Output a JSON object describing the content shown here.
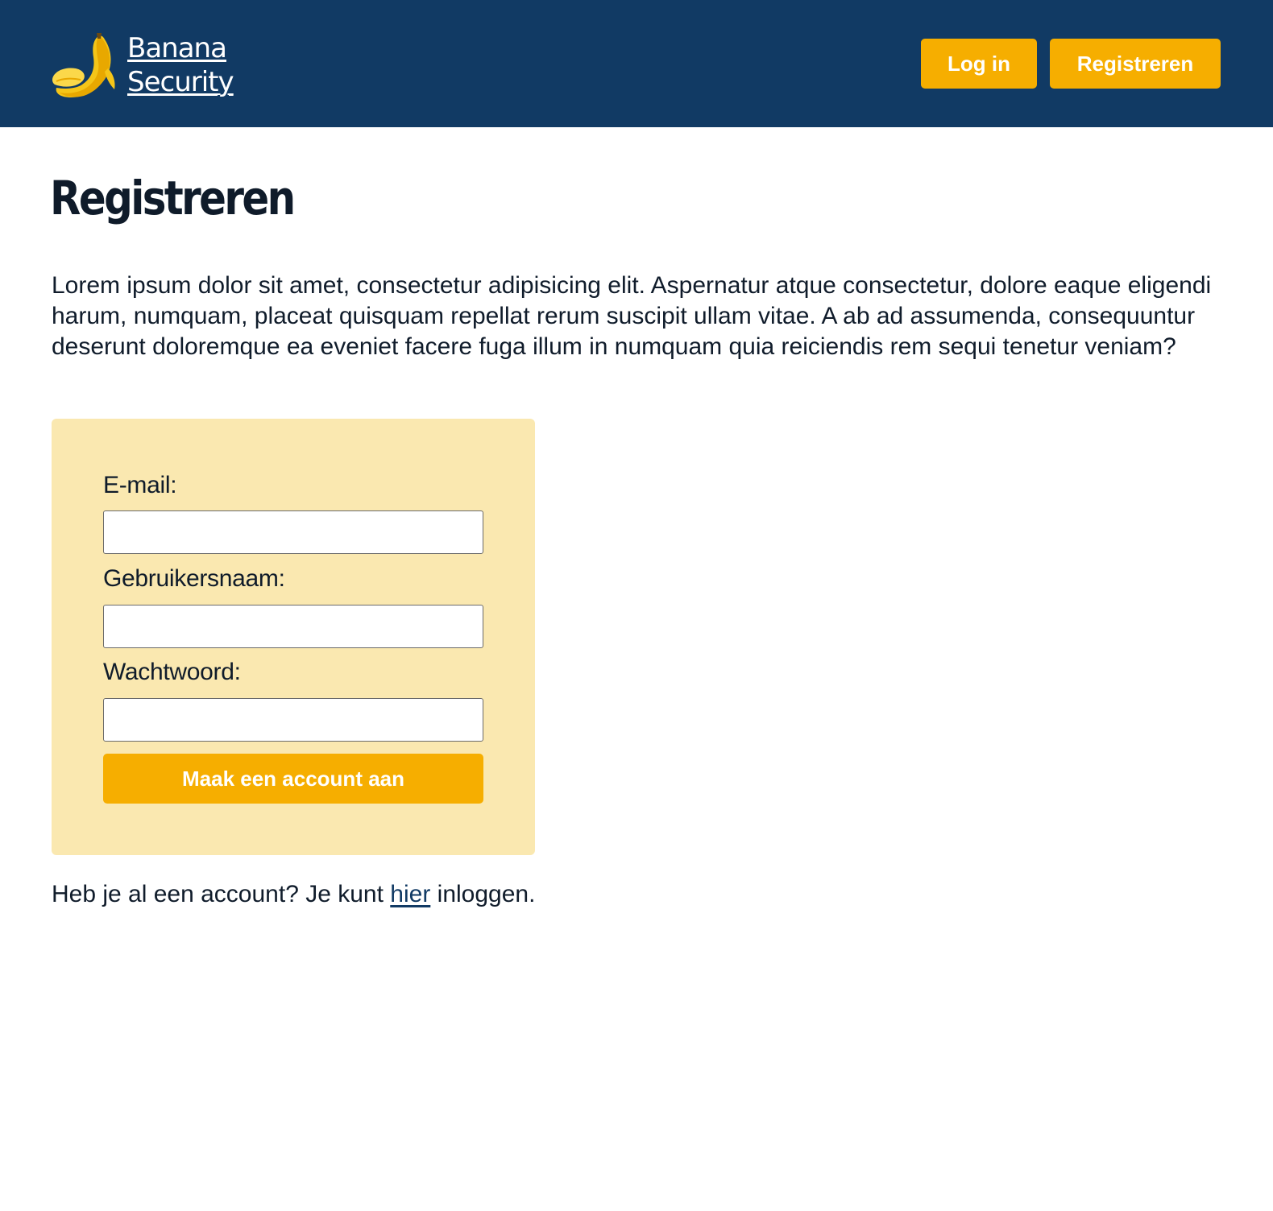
{
  "header": {
    "brand_line1": "Banana",
    "brand_line2": "Security",
    "logo_icon": "banana-icon",
    "login_label": "Log in",
    "register_label": "Registreren"
  },
  "main": {
    "title": "Registreren",
    "intro": "Lorem ipsum dolor sit amet, consectetur adipisicing elit. Aspernatur atque consectetur, dolore eaque eligendi harum, numquam, placeat quisquam repellat rerum suscipit ullam vitae. A ab ad assumenda, consequuntur deserunt doloremque ea eveniet facere fuga illum in numquam quia reiciendis rem sequi tenetur veniam?"
  },
  "form": {
    "email_label": "E-mail:",
    "email_value": "",
    "username_label": "Gebruikersnaam:",
    "username_value": "",
    "password_label": "Wachtwoord:",
    "password_value": "",
    "submit_label": "Maak een account aan"
  },
  "footer": {
    "prefix": "Heb je al een account? Je kunt ",
    "link_label": "hier",
    "suffix": " inloggen."
  },
  "colors": {
    "header_bg": "#113a64",
    "accent": "#f6ae00",
    "form_bg": "#fae8b0",
    "link": "#113a64"
  }
}
